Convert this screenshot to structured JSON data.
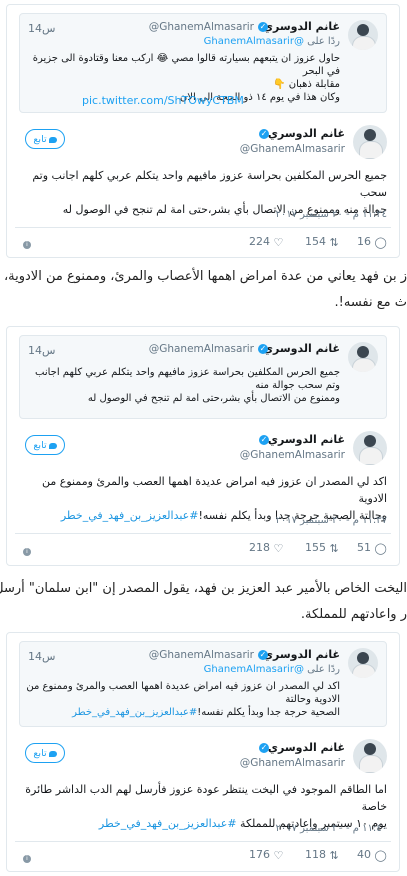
{
  "tweets": [
    {
      "quote": {
        "time": "14س",
        "name": "غانم الدوسري",
        "handle": "@GhanemAlmasarir",
        "reply_prefix": "ردًا على",
        "reply_handle": "@GhanemAlmasarir",
        "lines": [
          "حاول عزوز ان يتبعهم بسيارته قالوا مصي 😂 اركب معنا وقتادوة الى جزيرة في البحر",
          "مقابلة ذهبان 👇",
          "وكان هذا في يوم ١٤ ذو الحجة الى الان"
        ],
        "link": "pic.twitter.com/ShTOwyCTBM"
      },
      "name": "غانم الدوسري",
      "handle": "@GhanemAlmasarir",
      "follow": "تابع",
      "text_lines": [
        "جميع الحرس المكلفين بحراسة عزوز مافيهم واحد يتكلم عربي كلهم اجانب وتم سحب",
        "جوالة منه وممنوع من الاتصال بأي بشر،حتى امة لم تنجح في الوصول له"
      ],
      "hashtag": "",
      "date": "١١:٣٤ م - ٢٠ سبتمبر ٢٠١٧",
      "replies": "16",
      "retweets": "154",
      "likes": "224"
    },
    {
      "quote": {
        "time": "14س",
        "name": "غانم الدوسري",
        "handle": "@GhanemAlmasarir",
        "reply_prefix": "",
        "reply_handle": "",
        "lines": [
          "جميع الحرس المكلفين بحراسة عزوز مافيهم واحد يتكلم عربي كلهم اجانب وتم سحب جوالة منه",
          "وممنوع من الاتصال بأي بشر،حتى امة لم تنجح في الوصول له"
        ],
        "link": ""
      },
      "name": "غانم الدوسري",
      "handle": "@GhanemAlmasarir",
      "follow": "تابع",
      "text_lines": [
        "اكد لي المصدر ان عزوز فيه امراض عديدة اهمها العصب والمرئ وممنوع من الادوية",
        "وحالتة الصحية حرجة جدا وبدأ يكلم نفسه!"
      ],
      "hashtag": "#عبدالعزيز_بن_فهد_في_خطر",
      "date": "١١:٣٧ م - ٢٠ سبتمبر ٢٠١٧",
      "replies": "51",
      "retweets": "155",
      "likes": "218"
    },
    {
      "quote": {
        "time": "14س",
        "name": "غانم الدوسري",
        "handle": "@GhanemAlmasarir",
        "reply_prefix": "ردًا على",
        "reply_handle": "@GhanemAlmasarir",
        "lines": [
          "اكد لي المصدر ان عزوز فيه امراض عديدة اهمها العصب والمرئ وممنوع من الادوية وحالتة",
          "الصحية حرجة جدا وبدأ يكلم نفسه!"
        ],
        "hashtag": "#عبدالعزيز_بن_فهد_في_خطر",
        "link": ""
      },
      "name": "غانم الدوسري",
      "handle": "@GhanemAlmasarir",
      "follow": "تابع",
      "text_lines": [
        "اما الطاقم الموجود في اليخت ينتظر عودة عزوز فأرسل لهم الدب الداشر طائرة خاصة",
        "يوم ١٠ سبتمبر واعادتهم للمملكة"
      ],
      "hashtag": "#عبدالعزيز_بن_فهد_في_خطر",
      "date": "١١:٤٠ م - ٢٠ سبتمبر ٢٠١٧",
      "replies": "40",
      "retweets": "118",
      "likes": "176"
    }
  ],
  "paragraphs": [
    [
      "ز بن فهد يعاني من عدة امراض اهمها الأعصاب والمرئ، وممنوع من الادوية،",
      "ث مع نفسه!."
    ],
    [
      "اليخت الخاص بالأمير عبد العزيز بن فهد، يقول المصدر إن \"ابن سلمان\" أرسل",
      "ر واعادتهم للمملكة."
    ]
  ],
  "colors": {
    "accent": "#1da1f2",
    "border": "#e1e8ed",
    "muted": "#657786"
  }
}
